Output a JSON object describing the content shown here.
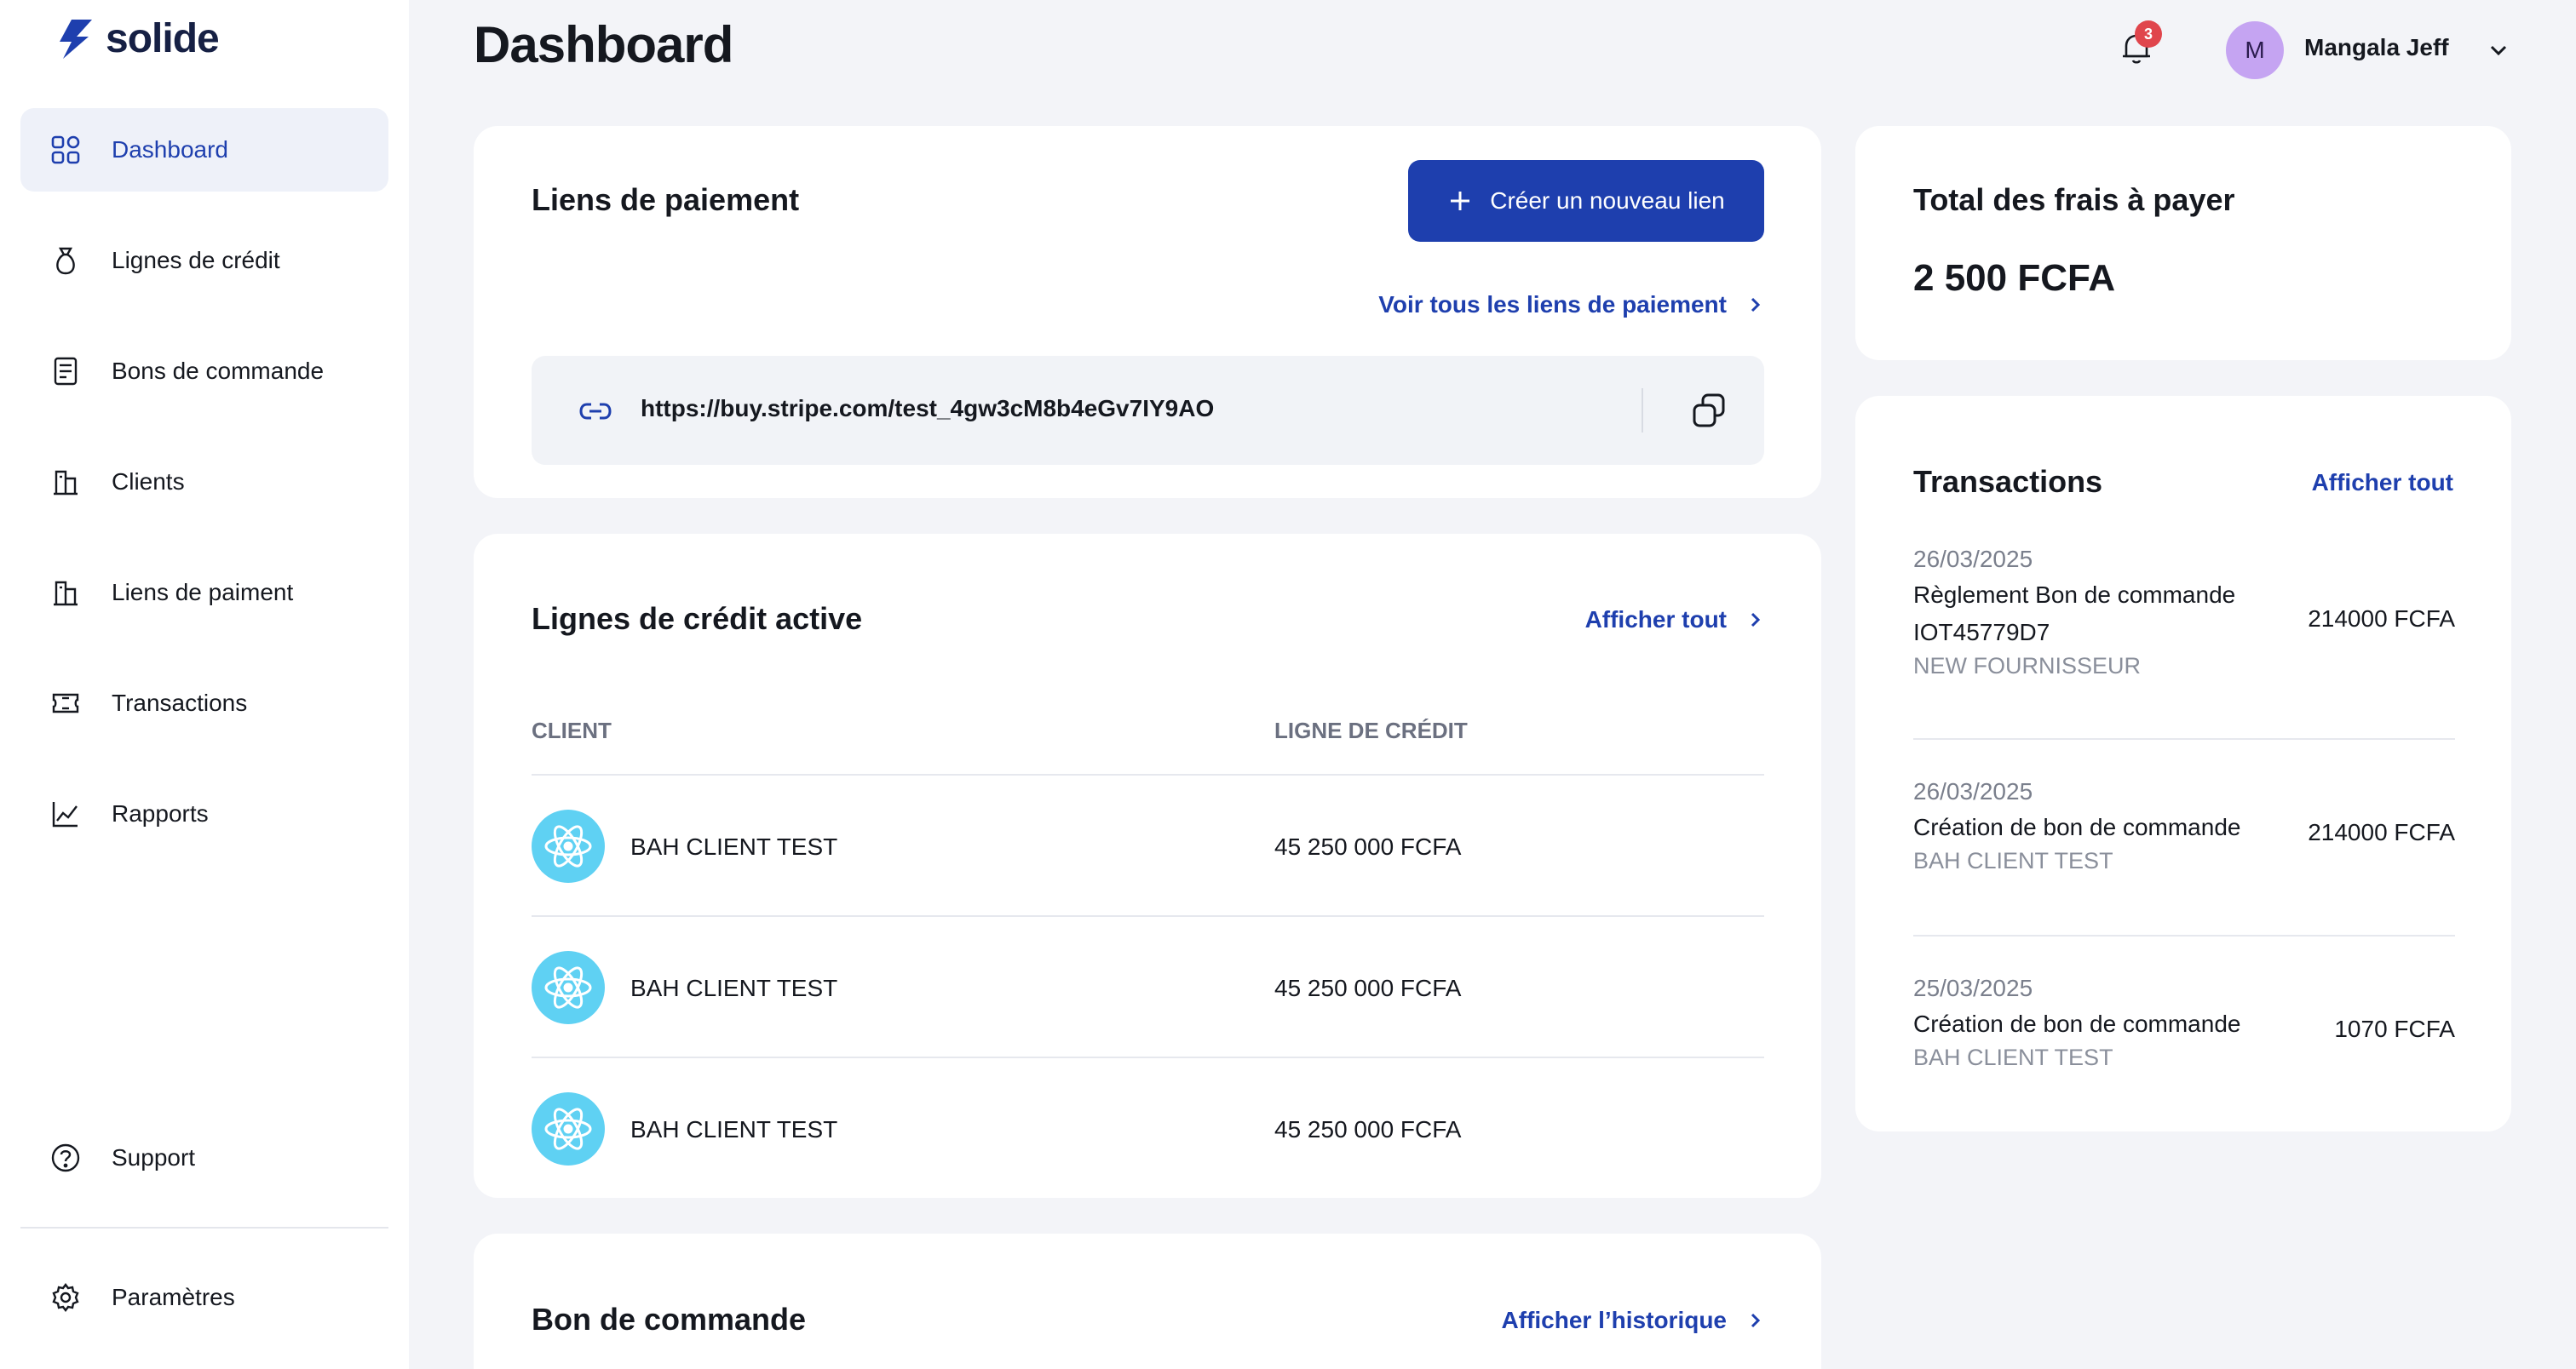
{
  "brand": {
    "name": "solide",
    "accent": "#1e3fae"
  },
  "sidebar": {
    "items": [
      {
        "label": "Dashboard",
        "icon": "grid-icon",
        "active": true
      },
      {
        "label": "Lignes de crédit",
        "icon": "money-bag-icon"
      },
      {
        "label": "Bons de commande",
        "icon": "document-list-icon"
      },
      {
        "label": "Clients",
        "icon": "building-icon"
      },
      {
        "label": "Liens de paiment",
        "icon": "building-icon"
      },
      {
        "label": "Transactions",
        "icon": "ticket-icon"
      },
      {
        "label": "Rapports",
        "icon": "line-chart-icon"
      }
    ],
    "support": {
      "label": "Support",
      "icon": "help-circle-icon"
    },
    "settings": {
      "label": "Paramètres",
      "icon": "gear-icon"
    }
  },
  "header": {
    "title": "Dashboard",
    "notifications": {
      "count": "3",
      "icon": "bell-icon"
    },
    "user": {
      "initial": "M",
      "name": "Mangala Jeff"
    }
  },
  "payment_links": {
    "title": "Liens de paiement",
    "create_button": "Créer un nouveau lien",
    "see_all": "Voir tous les liens de paiement",
    "url": "https://buy.stripe.com/test_4gw3cM8b4eGv7IY9AO"
  },
  "credit_lines": {
    "title": "Lignes de crédit active",
    "see_all": "Afficher tout",
    "columns": [
      "CLIENT",
      "LIGNE DE CRÉDIT"
    ],
    "rows": [
      {
        "client": "BAH CLIENT TEST",
        "credit": "45 250 000 FCFA"
      },
      {
        "client": "BAH CLIENT TEST",
        "credit": "45 250 000 FCFA"
      },
      {
        "client": "BAH CLIENT TEST",
        "credit": "45 250 000 FCFA"
      }
    ]
  },
  "purchase_orders": {
    "title": "Bon de commande",
    "history_link": "Afficher l’historique"
  },
  "fees": {
    "title": "Total des frais à payer",
    "amount": "2 500 FCFA"
  },
  "transactions": {
    "title": "Transactions",
    "see_all": "Afficher tout",
    "items": [
      {
        "date": "26/03/2025",
        "label": "Règlement Bon de commande IOT45779D7",
        "party": "NEW FOURNISSEUR",
        "amount": "214000 FCFA"
      },
      {
        "date": "26/03/2025",
        "label": "Création de bon de commande",
        "party": "BAH CLIENT TEST",
        "amount": "214000 FCFA"
      },
      {
        "date": "25/03/2025",
        "label": "Création de bon de commande",
        "party": "BAH CLIENT TEST",
        "amount": "1070 FCFA"
      }
    ]
  }
}
